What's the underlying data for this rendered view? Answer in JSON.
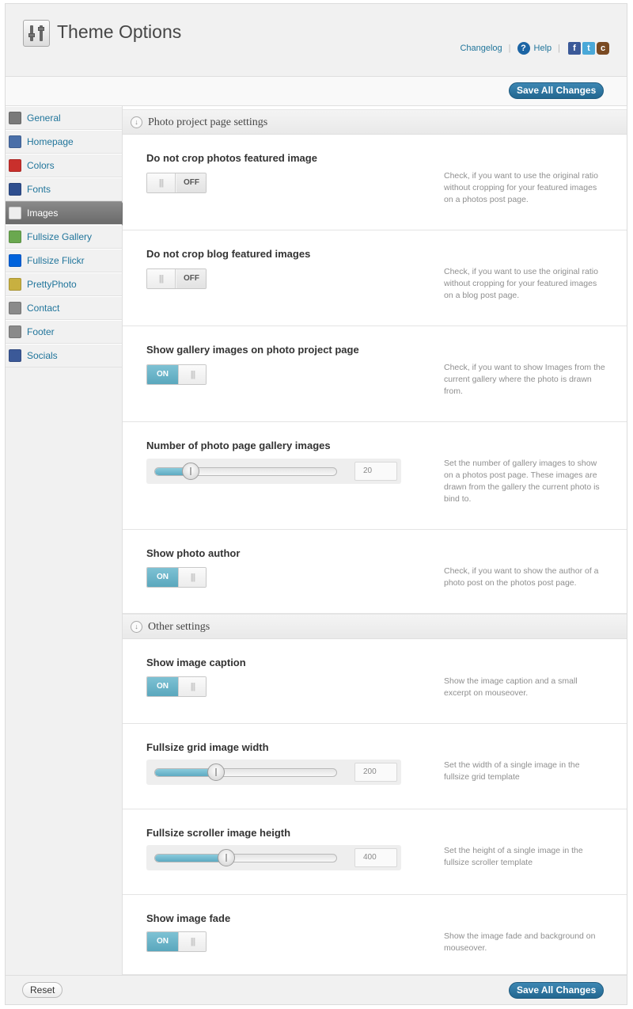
{
  "header": {
    "title": "Theme Options",
    "links": {
      "changelog": "Changelog",
      "help": "Help"
    },
    "social_icons": [
      "facebook-icon",
      "twitter-icon",
      "cb-icon"
    ]
  },
  "toolbar": {
    "save_label": "Save All Changes"
  },
  "sidebar": {
    "items": [
      {
        "label": "General",
        "icon": "tools-icon",
        "color": "#7a7a7a"
      },
      {
        "label": "Homepage",
        "icon": "home-icon",
        "color": "#4a6fa8"
      },
      {
        "label": "Colors",
        "icon": "palette-grid-icon",
        "color": "#c9302c"
      },
      {
        "label": "Fonts",
        "icon": "font-a-icon",
        "color": "#2f4f8f"
      },
      {
        "label": "Images",
        "icon": "images-icon",
        "color": "#eeeeee",
        "active": true
      },
      {
        "label": "Fullsize Gallery",
        "icon": "gallery-icon",
        "color": "#6aa84f"
      },
      {
        "label": "Fullsize Flickr",
        "icon": "flickr-icon",
        "color": "#0063dc"
      },
      {
        "label": "PrettyPhoto",
        "icon": "prettyphoto-icon",
        "color": "#c8b040"
      },
      {
        "label": "Contact",
        "icon": "contact-card-icon",
        "color": "#8a8a8a"
      },
      {
        "label": "Footer",
        "icon": "footer-icon",
        "color": "#8a8a8a"
      },
      {
        "label": "Socials",
        "icon": "facebook-icon",
        "color": "#3b5998"
      }
    ]
  },
  "sections": [
    {
      "title": "Photo project page settings"
    },
    {
      "title": "Other settings"
    }
  ],
  "options": [
    {
      "title": "Do not crop photos featured image",
      "type": "toggle",
      "state": "OFF",
      "description": "Check, if you want to use the original ratio without cropping for your featured images on a photos post page."
    },
    {
      "title": "Do not crop blog featured images",
      "type": "toggle",
      "state": "OFF",
      "description": "Check, if you want to use the original ratio without cropping for your featured images on a blog post page."
    },
    {
      "title": "Show gallery images on photo project page",
      "type": "toggle",
      "state": "ON",
      "description": "Check, if you want to show Images from the current gallery where the photo is drawn from."
    },
    {
      "title": "Number of photo page gallery images",
      "type": "slider",
      "value": "20",
      "level": 0.19,
      "description": "Set the number of gallery images to show on a photos post page. These images are drawn from the gallery the current photo is bind to."
    },
    {
      "title": "Show photo author",
      "type": "toggle",
      "state": "ON",
      "description": "Check, if you want to show the author of a photo post on the photos post page."
    },
    {
      "title": "Show image caption",
      "type": "toggle",
      "state": "ON",
      "description": "Show the image caption and a small excerpt on mouseover."
    },
    {
      "title": "Fullsize grid image width",
      "type": "slider",
      "value": "200",
      "level": 0.33,
      "description": "Set the width of a single image in the fullsize grid template"
    },
    {
      "title": "Fullsize scroller image heigth",
      "type": "slider",
      "value": "400",
      "level": 0.39,
      "description": "Set the height of a single image in the fullsize scroller template"
    },
    {
      "title": "Show image fade",
      "type": "toggle",
      "state": "ON",
      "description": "Show the image fade and background on mouseover."
    }
  ],
  "footer": {
    "reset_label": "Reset",
    "save_label": "Save All Changes"
  },
  "colors": {
    "accent": "#21759b",
    "toggle_on": "#6bb5c9",
    "button": "#2e77a2"
  }
}
